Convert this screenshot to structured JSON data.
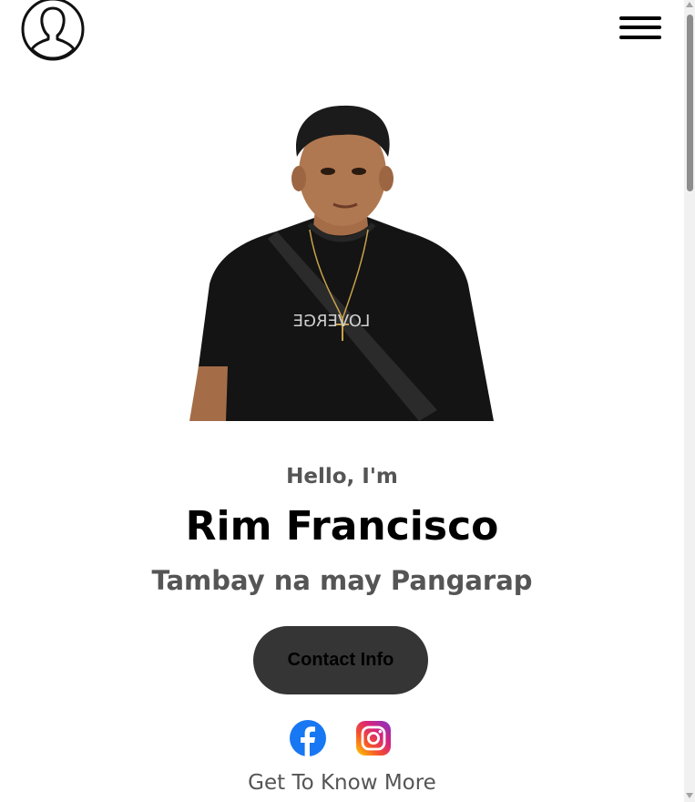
{
  "header": {
    "logo_icon": "user-silhouette-icon",
    "menu_icon": "hamburger-menu-icon"
  },
  "hero": {
    "photo": "profile-photo",
    "greeting": "Hello, I'm",
    "name": "Rim Francisco",
    "tagline": "Tambay na may Pangarap",
    "contact_button": "Contact Info",
    "socials": [
      {
        "name": "facebook",
        "icon": "facebook-icon",
        "color": "#1877f2"
      },
      {
        "name": "instagram",
        "icon": "instagram-icon",
        "color": "#e1306c"
      }
    ],
    "more_link": "Get To Know More",
    "shirt_text": "LOVERGE"
  },
  "colors": {
    "text_dark": "#000000",
    "text_muted": "#555555",
    "button_bg": "#353535"
  }
}
